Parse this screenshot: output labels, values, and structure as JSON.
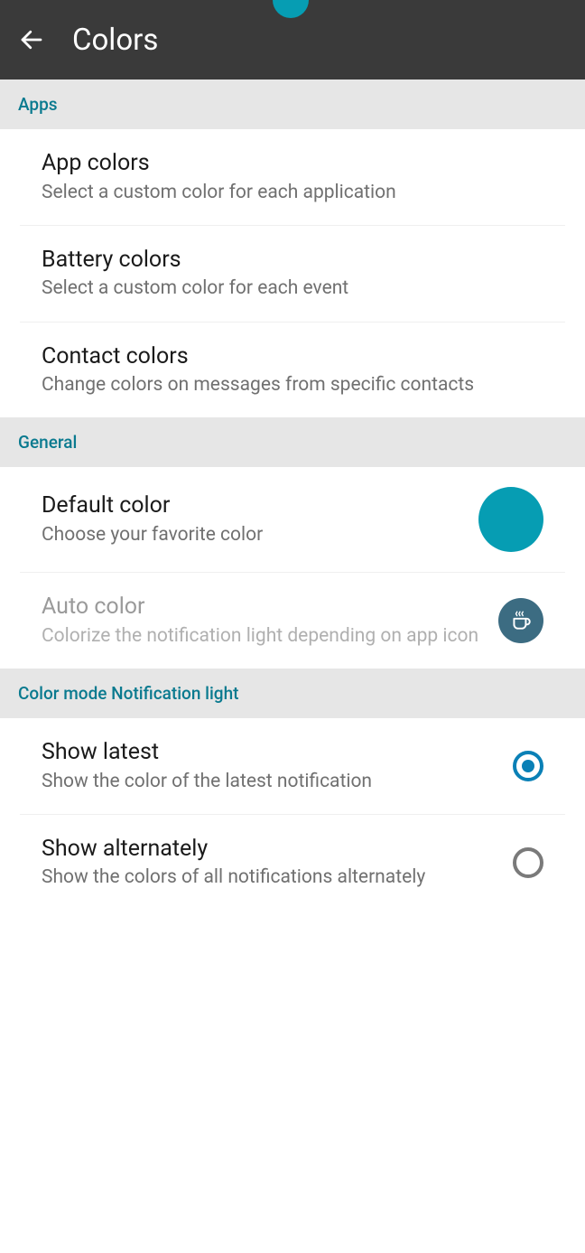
{
  "appbar": {
    "title": "Colors"
  },
  "sections": {
    "apps": {
      "header": "Apps",
      "items": [
        {
          "title": "App colors",
          "subtitle": "Select a custom color for each application"
        },
        {
          "title": "Battery colors",
          "subtitle": "Select a custom color for each event"
        },
        {
          "title": "Contact colors",
          "subtitle": "Change colors on messages from specific contacts"
        }
      ]
    },
    "general": {
      "header": "General",
      "default_color": {
        "title": "Default color",
        "subtitle": "Choose your favorite color",
        "color": "#069db3"
      },
      "auto_color": {
        "title": "Auto color",
        "subtitle": "Colorize the notification light depending on app icon"
      }
    },
    "color_mode": {
      "header": "Color mode Notification light",
      "show_latest": {
        "title": "Show latest",
        "subtitle": "Show the color of the latest notification",
        "selected": true
      },
      "show_alternately": {
        "title": "Show alternately",
        "subtitle": "Show the colors of all notifications alternately",
        "selected": false
      }
    }
  }
}
